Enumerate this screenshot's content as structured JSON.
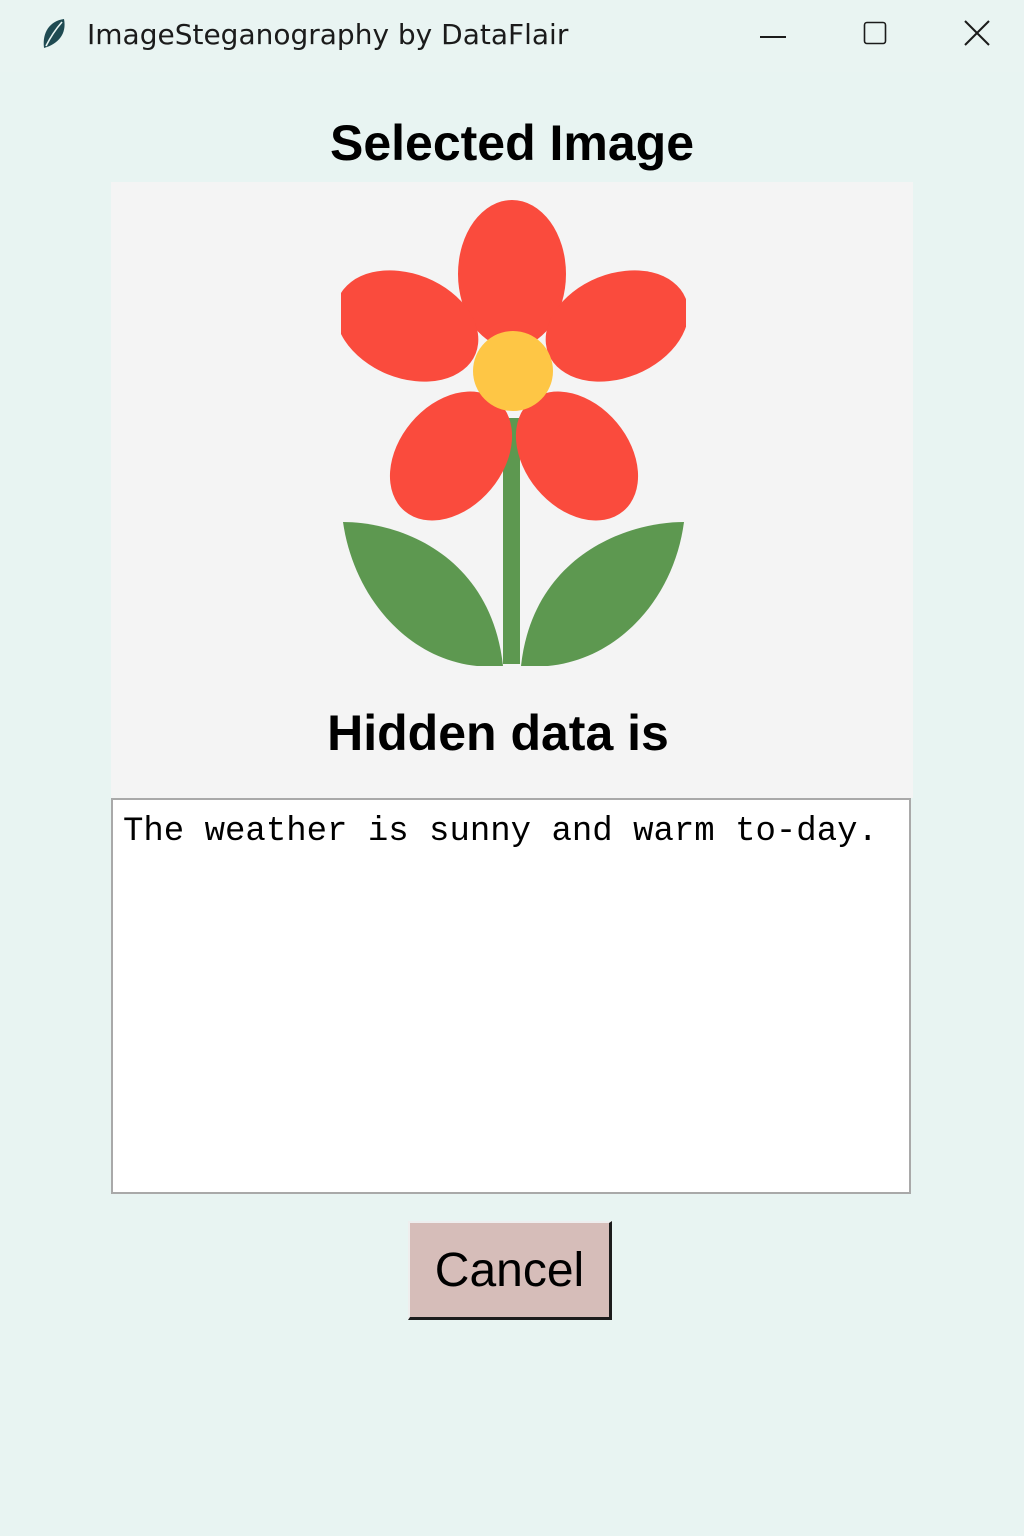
{
  "window": {
    "title": "ImageSteganography by DataFlair",
    "app_icon": "leaf-icon",
    "controls": {
      "minimize_icon": "minimize-icon",
      "maximize_icon": "maximize-icon",
      "close_icon": "close-icon"
    }
  },
  "main": {
    "selected_image_heading": "Selected Image",
    "image_content": "flower-image",
    "hidden_data_heading": "Hidden data is",
    "hidden_text": "The weather is sunny and warm to-day.",
    "cancel_label": "Cancel"
  },
  "colors": {
    "window_background": "#e8f4f2",
    "image_background": "#f4f4f4",
    "petal": "#fa4b3d",
    "flower_center": "#fec645",
    "stem_leaf": "#5d9850",
    "cancel_button": "#d6bdb9"
  }
}
